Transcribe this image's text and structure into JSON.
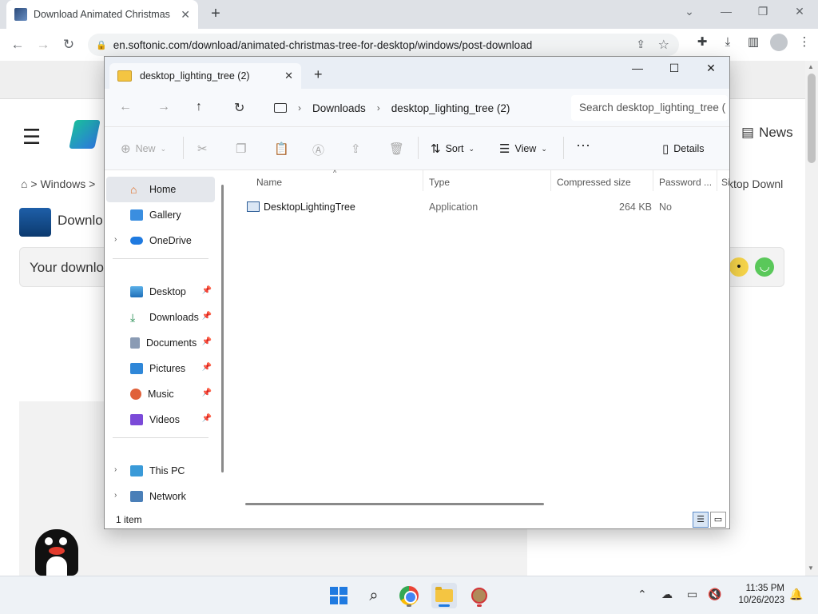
{
  "browser": {
    "tab_title": "Download Animated Christmas",
    "url": "en.softonic.com/download/animated-christmas-tree-for-desktop/windows/post-download"
  },
  "page": {
    "news_label": "News",
    "crumb_left": "Windows >",
    "crumb_right": "sktop Downl",
    "download_title": "Downlo",
    "banner_text": "Your downlo"
  },
  "explorer": {
    "tab_title": "desktop_lighting_tree (2)",
    "breadcrumb": [
      "Downloads",
      "desktop_lighting_tree (2)"
    ],
    "search_placeholder": "Search desktop_lighting_tree (",
    "commands": {
      "new": "New",
      "sort": "Sort",
      "view": "View",
      "details": "Details"
    },
    "nav": {
      "home": "Home",
      "gallery": "Gallery",
      "onedrive": "OneDrive",
      "desktop": "Desktop",
      "downloads": "Downloads",
      "documents": "Documents",
      "pictures": "Pictures",
      "music": "Music",
      "videos": "Videos",
      "thispc": "This PC",
      "network": "Network"
    },
    "columns": {
      "name": "Name",
      "type": "Type",
      "size": "Compressed size",
      "password": "Password ...",
      "extra": "Si"
    },
    "files": [
      {
        "name": "DesktopLightingTree",
        "type": "Application",
        "size": "264 KB",
        "password": "No"
      }
    ],
    "status": "1 item"
  },
  "taskbar": {
    "time": "11:35 PM",
    "date": "10/26/2023"
  }
}
